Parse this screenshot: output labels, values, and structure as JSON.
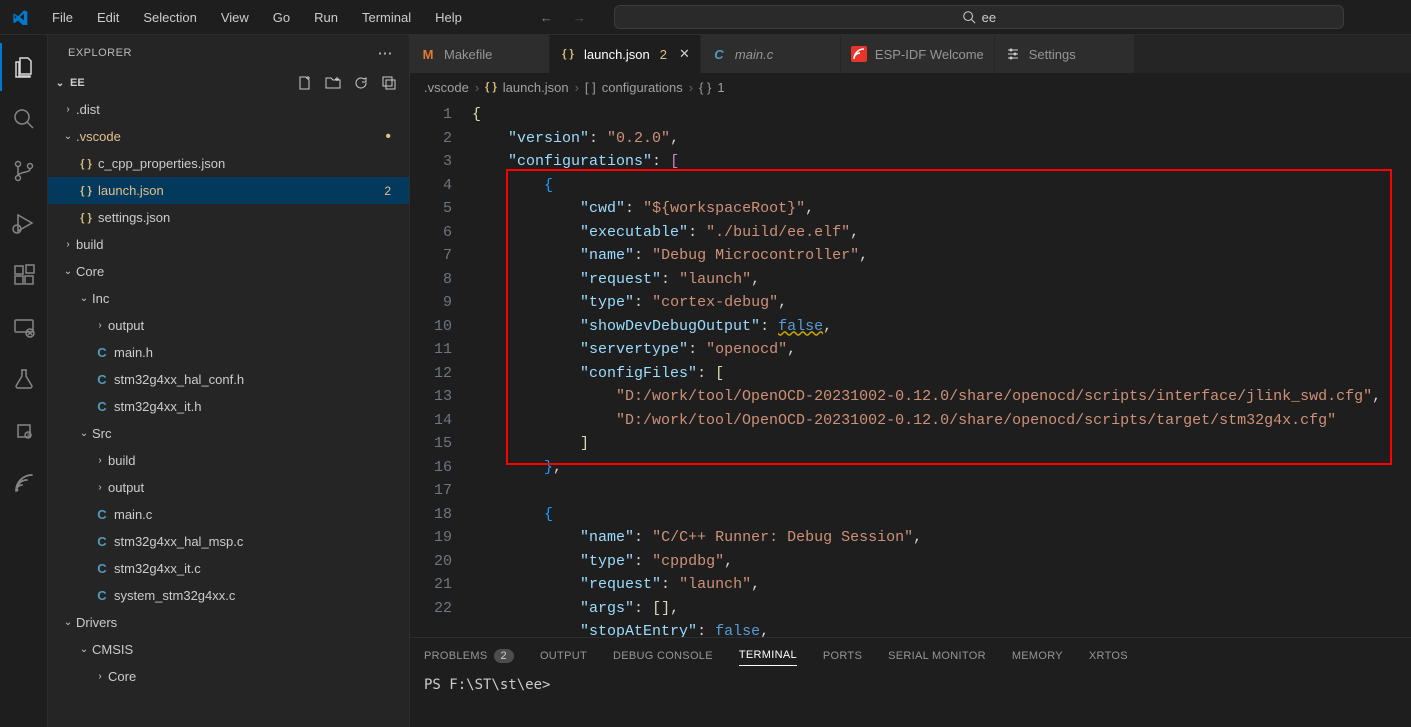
{
  "menu": [
    "File",
    "Edit",
    "Selection",
    "View",
    "Go",
    "Run",
    "Terminal",
    "Help"
  ],
  "search": {
    "text": "ee"
  },
  "explorer": {
    "title": "EXPLORER",
    "root": "EE",
    "tree": {
      "dist": ".dist",
      "vscode": ".vscode",
      "c_cpp": "c_cpp_properties.json",
      "launch": "launch.json",
      "launch_badge": "2",
      "settings": "settings.json",
      "build": "build",
      "core": "Core",
      "inc": "Inc",
      "output1": "output",
      "mainh": "main.h",
      "hal_conf": "stm32g4xx_hal_conf.h",
      "ith": "stm32g4xx_it.h",
      "src": "Src",
      "build2": "build",
      "output2": "output",
      "mainc": "main.c",
      "hal_msp": "stm32g4xx_hal_msp.c",
      "itc": "stm32g4xx_it.c",
      "system": "system_stm32g4xx.c",
      "drivers": "Drivers",
      "cmsis": "CMSIS",
      "core2": "Core"
    }
  },
  "tabs": {
    "makefile": "Makefile",
    "launch": "launch.json",
    "launch_mod": "2",
    "mainc": "main.c",
    "espidf": "ESP-IDF Welcome",
    "settings": "Settings"
  },
  "breadcrumb": {
    "p1": ".vscode",
    "p2": "launch.json",
    "p3": "configurations",
    "p4": "1"
  },
  "code": {
    "l1": "{",
    "l2a": "\"version\"",
    "l2b": "\"0.2.0\"",
    "l3a": "\"configurations\"",
    "l5a": "\"cwd\"",
    "l5b": "\"${workspaceRoot}\"",
    "l6a": "\"executable\"",
    "l6b": "\"./build/ee.elf\"",
    "l7a": "\"name\"",
    "l7b": "\"Debug Microcontroller\"",
    "l8a": "\"request\"",
    "l8b": "\"launch\"",
    "l9a": "\"type\"",
    "l9b": "\"cortex-debug\"",
    "l10a": "\"showDevDebugOutput\"",
    "l10b": "false",
    "l11a": "\"servertype\"",
    "l11b": "\"openocd\"",
    "l12a": "\"configFiles\"",
    "l13": "\"D:/work/tool/OpenOCD-20231002-0.12.0/share/openocd/scripts/interface/jlink_swd.cfg\"",
    "l14": "\"D:/work/tool/OpenOCD-20231002-0.12.0/share/openocd/scripts/target/stm32g4x.cfg\"",
    "l18a": "\"name\"",
    "l18b": "\"C/C++ Runner: Debug Session\"",
    "l19a": "\"type\"",
    "l19b": "\"cppdbg\"",
    "l20a": "\"request\"",
    "l20b": "\"launch\"",
    "l21a": "\"args\"",
    "l22a": "\"stopAtEntry\"",
    "l22b": "false"
  },
  "line_numbers": [
    "1",
    "2",
    "3",
    "4",
    "5",
    "6",
    "7",
    "8",
    "9",
    "10",
    "11",
    "12",
    "13",
    "14",
    "15",
    "16",
    "17",
    "18",
    "19",
    "20",
    "21",
    "22"
  ],
  "panel": {
    "problems": "PROBLEMS",
    "problems_count": "2",
    "output": "OUTPUT",
    "debug": "DEBUG CONSOLE",
    "terminal": "TERMINAL",
    "ports": "PORTS",
    "serial": "SERIAL MONITOR",
    "memory": "MEMORY",
    "xrtos": "XRTOS"
  },
  "terminal": {
    "prompt": "PS F:\\ST\\st\\ee>"
  }
}
